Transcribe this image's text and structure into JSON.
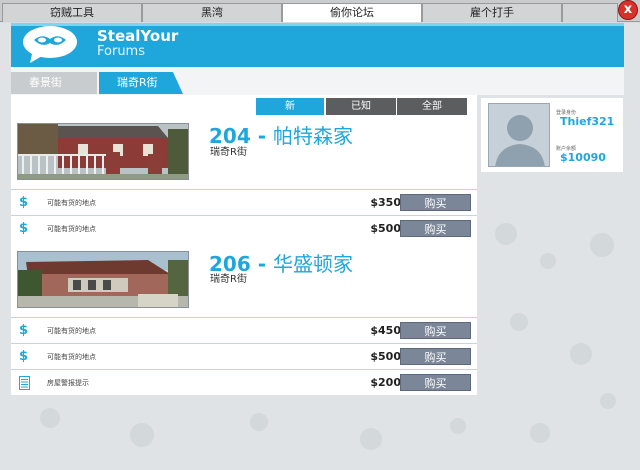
{
  "top_tabs": [
    "窃贼工具",
    "黑湾",
    "偷你论坛",
    "雇个打手"
  ],
  "active_top_tab": "偷你论坛",
  "close_symbol": "x",
  "brand": {
    "title": "StealYour",
    "subtitle": "Forums"
  },
  "street_tabs": [
    {
      "label": "春景街",
      "active": false
    },
    {
      "label": "瑞奇R街",
      "active": true
    }
  ],
  "filters": [
    {
      "label": "新",
      "active": true
    },
    {
      "label": "已知",
      "active": false
    },
    {
      "label": "全部",
      "active": false
    }
  ],
  "houses": [
    {
      "number": "204 -",
      "name": "帕特森家",
      "street": "瑞奇R街",
      "items": [
        {
          "icon": "dollar-icon",
          "label": "可能有货的地点",
          "price": "$350",
          "button": "购买"
        },
        {
          "icon": "dollar-icon",
          "label": "可能有货的地点",
          "price": "$500",
          "button": "购买"
        }
      ]
    },
    {
      "number": "206 -",
      "name": "华盛顿家",
      "street": "瑞奇R街",
      "items": [
        {
          "icon": "dollar-icon",
          "label": "可能有货的地点",
          "price": "$450",
          "button": "购买"
        },
        {
          "icon": "dollar-icon",
          "label": "可能有货的地点",
          "price": "$500",
          "button": "购买"
        },
        {
          "icon": "document-icon",
          "label": "房屋警报提示",
          "price": "$200",
          "button": "购买"
        }
      ]
    }
  ],
  "profile": {
    "identity_label": "登录身份",
    "username": "Thief321",
    "balance_label": "账户余额",
    "balance": "$10090"
  },
  "colors": {
    "accent": "#1fa7dc",
    "button": "#7b8799",
    "inactive_filter": "#5b5d5e"
  }
}
